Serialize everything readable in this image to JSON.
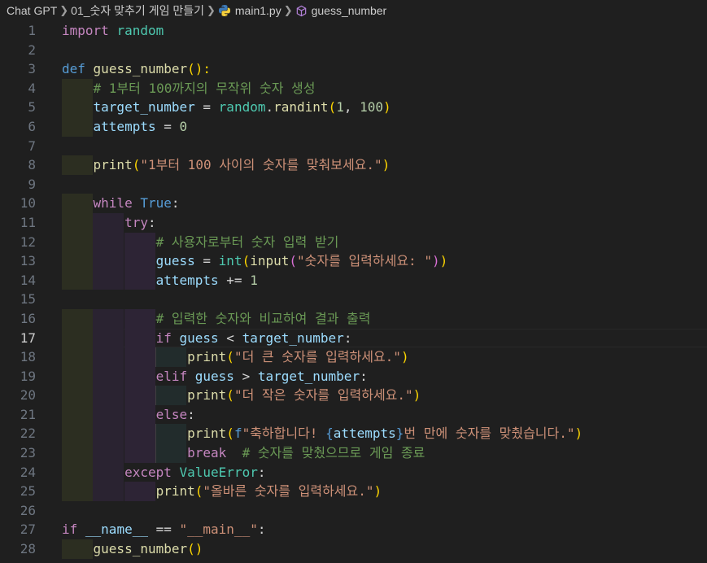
{
  "breadcrumb": {
    "items": [
      "Chat GPT",
      "01_숫자 맞추기 게임 만들기",
      "main1.py",
      "guess_number"
    ],
    "icons": [
      "chevron-right-icon",
      "python-file-icon",
      "symbol-method-icon"
    ]
  },
  "editor": {
    "language": "python",
    "current_line": 17,
    "lines": [
      {
        "n": "1",
        "t": [
          [
            "kw",
            "import"
          ],
          [
            "p",
            " "
          ],
          [
            "cls",
            "random"
          ]
        ]
      },
      {
        "n": "2",
        "t": []
      },
      {
        "n": "3",
        "t": [
          [
            "kd",
            "def"
          ],
          [
            "p",
            " "
          ],
          [
            "fn",
            "guess_number"
          ],
          [
            "br1",
            "():"
          ]
        ]
      },
      {
        "n": "4",
        "t": [
          [
            "p",
            "    "
          ],
          [
            "cmt",
            "# 1부터 100까지의 무작위 숫자 생성"
          ]
        ]
      },
      {
        "n": "5",
        "t": [
          [
            "p",
            "    "
          ],
          [
            "var",
            "target_number"
          ],
          [
            "op",
            " = "
          ],
          [
            "cls",
            "random"
          ],
          [
            "op",
            "."
          ],
          [
            "fn",
            "randint"
          ],
          [
            "br1",
            "("
          ],
          [
            "num",
            "1"
          ],
          [
            "op",
            ", "
          ],
          [
            "num",
            "100"
          ],
          [
            "br1",
            ")"
          ]
        ]
      },
      {
        "n": "6",
        "t": [
          [
            "p",
            "    "
          ],
          [
            "var",
            "attempts"
          ],
          [
            "op",
            " = "
          ],
          [
            "num",
            "0"
          ]
        ]
      },
      {
        "n": "7",
        "t": []
      },
      {
        "n": "8",
        "t": [
          [
            "p",
            "    "
          ],
          [
            "fn",
            "print"
          ],
          [
            "br1",
            "("
          ],
          [
            "str",
            "\"1부터 100 사이의 숫자를 맞춰보세요.\""
          ],
          [
            "br1",
            ")"
          ]
        ]
      },
      {
        "n": "9",
        "t": []
      },
      {
        "n": "10",
        "t": [
          [
            "p",
            "    "
          ],
          [
            "kw",
            "while"
          ],
          [
            "p",
            " "
          ],
          [
            "kd",
            "True"
          ],
          [
            "op",
            ":"
          ]
        ]
      },
      {
        "n": "11",
        "t": [
          [
            "p",
            "        "
          ],
          [
            "kw",
            "try"
          ],
          [
            "op",
            ":"
          ]
        ]
      },
      {
        "n": "12",
        "t": [
          [
            "p",
            "            "
          ],
          [
            "cmt",
            "# 사용자로부터 숫자 입력 받기"
          ]
        ]
      },
      {
        "n": "13",
        "t": [
          [
            "p",
            "            "
          ],
          [
            "var",
            "guess"
          ],
          [
            "op",
            " = "
          ],
          [
            "cls",
            "int"
          ],
          [
            "br1",
            "("
          ],
          [
            "fn",
            "input"
          ],
          [
            "br2",
            "("
          ],
          [
            "str",
            "\"숫자를 입력하세요: \""
          ],
          [
            "br2",
            ")"
          ],
          [
            "br1",
            ")"
          ]
        ]
      },
      {
        "n": "14",
        "t": [
          [
            "p",
            "            "
          ],
          [
            "var",
            "attempts"
          ],
          [
            "op",
            " += "
          ],
          [
            "num",
            "1"
          ]
        ]
      },
      {
        "n": "15",
        "t": []
      },
      {
        "n": "16",
        "t": [
          [
            "p",
            "            "
          ],
          [
            "cmt",
            "# 입력한 숫자와 비교하여 결과 출력"
          ]
        ]
      },
      {
        "n": "17",
        "t": [
          [
            "p",
            "            "
          ],
          [
            "kw",
            "if"
          ],
          [
            "p",
            " "
          ],
          [
            "var",
            "guess"
          ],
          [
            "op",
            " < "
          ],
          [
            "var",
            "target_number"
          ],
          [
            "op",
            ":"
          ]
        ]
      },
      {
        "n": "18",
        "t": [
          [
            "p",
            "                "
          ],
          [
            "fn",
            "print"
          ],
          [
            "br1",
            "("
          ],
          [
            "str",
            "\"더 큰 숫자를 입력하세요.\""
          ],
          [
            "br1",
            ")"
          ]
        ]
      },
      {
        "n": "19",
        "t": [
          [
            "p",
            "            "
          ],
          [
            "kw",
            "elif"
          ],
          [
            "p",
            " "
          ],
          [
            "var",
            "guess"
          ],
          [
            "op",
            " > "
          ],
          [
            "var",
            "target_number"
          ],
          [
            "op",
            ":"
          ]
        ]
      },
      {
        "n": "20",
        "t": [
          [
            "p",
            "                "
          ],
          [
            "fn",
            "print"
          ],
          [
            "br1",
            "("
          ],
          [
            "str",
            "\"더 작은 숫자를 입력하세요.\""
          ],
          [
            "br1",
            ")"
          ]
        ]
      },
      {
        "n": "21",
        "t": [
          [
            "p",
            "            "
          ],
          [
            "kw",
            "else"
          ],
          [
            "op",
            ":"
          ]
        ]
      },
      {
        "n": "22",
        "t": [
          [
            "p",
            "                "
          ],
          [
            "fn",
            "print"
          ],
          [
            "br1",
            "("
          ],
          [
            "kd",
            "f"
          ],
          [
            "str",
            "\"축하합니다! "
          ],
          [
            "kd",
            "{"
          ],
          [
            "var",
            "attempts"
          ],
          [
            "kd",
            "}"
          ],
          [
            "str",
            "번 만에 숫자를 맞췄습니다.\""
          ],
          [
            "br1",
            ")"
          ]
        ]
      },
      {
        "n": "23",
        "t": [
          [
            "p",
            "                "
          ],
          [
            "kw",
            "break"
          ],
          [
            "p",
            "  "
          ],
          [
            "cmt",
            "# 숫자를 맞췄으므로 게임 종료"
          ]
        ]
      },
      {
        "n": "24",
        "t": [
          [
            "p",
            "        "
          ],
          [
            "kw",
            "except"
          ],
          [
            "p",
            " "
          ],
          [
            "cls",
            "ValueError"
          ],
          [
            "op",
            ":"
          ]
        ]
      },
      {
        "n": "25",
        "t": [
          [
            "p",
            "            "
          ],
          [
            "fn",
            "print"
          ],
          [
            "br1",
            "("
          ],
          [
            "str",
            "\"올바른 숫자를 입력하세요.\""
          ],
          [
            "br1",
            ")"
          ]
        ]
      },
      {
        "n": "26",
        "t": []
      },
      {
        "n": "27",
        "t": [
          [
            "kw",
            "if"
          ],
          [
            "p",
            " "
          ],
          [
            "var",
            "__name__"
          ],
          [
            "op",
            " == "
          ],
          [
            "str",
            "\"__main__\""
          ],
          [
            "op",
            ":"
          ]
        ]
      },
      {
        "n": "28",
        "t": [
          [
            "p",
            "    "
          ],
          [
            "fn",
            "guess_number"
          ],
          [
            "br1",
            "()"
          ]
        ]
      }
    ]
  },
  "colors": {
    "background": "#1f1f1f",
    "keyword_control": "#c586c0",
    "keyword": "#569cd6",
    "function": "#dcdcaa",
    "class": "#4ec9b0",
    "variable": "#9cdcfe",
    "number": "#b5cea8",
    "string": "#ce9178",
    "comment": "#6a9955",
    "bracket_level1": "#ffd700",
    "bracket_level2": "#da70d6"
  }
}
